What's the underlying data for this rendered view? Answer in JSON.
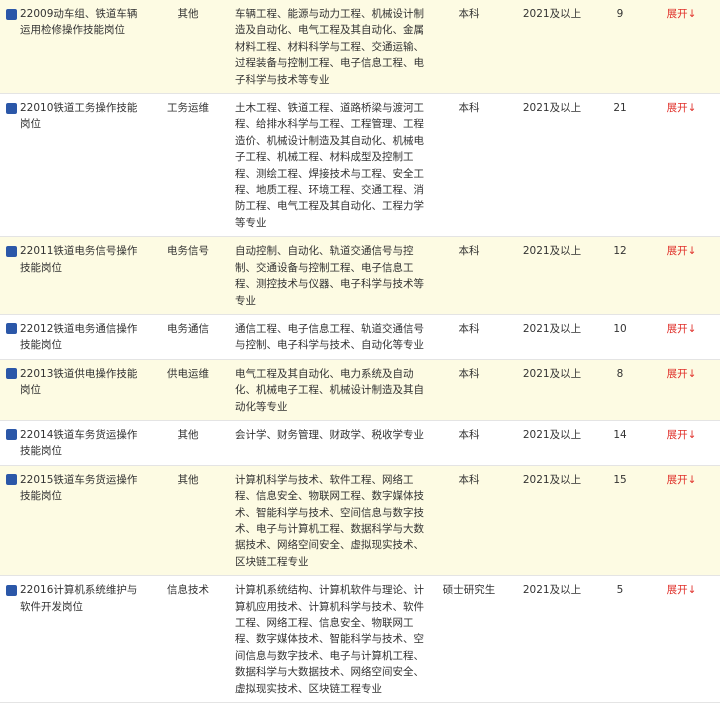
{
  "table": {
    "rows": [
      {
        "name": "22009动车组、铁道车辆运用检修操作技能岗位",
        "type": "其他",
        "major": "车辆工程、能源与动力工程、机械设计制造及自动化、电气工程及其自动化、金属材料工程、材料科学与工程、交通运输、过程装备与控制工程、电子信息工程、电子科学与技术等专业",
        "edu": "本科",
        "year": "2021及以上",
        "count": "9",
        "toggle": "展开",
        "arrow": "↓"
      },
      {
        "name": "22010铁道工务操作技能岗位",
        "type": "工务运维",
        "major": "土木工程、铁道工程、道路桥梁与渡河工程、给排水科学与工程、工程管理、工程造价、机械设计制造及其自动化、机械电子工程、机械工程、材料成型及控制工程、测绘工程、焊接技术与工程、安全工程、地质工程、环境工程、交通工程、消防工程、电气工程及其自动化、工程力学等专业",
        "edu": "本科",
        "year": "2021及以上",
        "count": "21",
        "toggle": "展开",
        "arrow": "↓"
      },
      {
        "name": "22011铁道电务信号操作技能岗位",
        "type": "电务信号",
        "major": "自动控制、自动化、轨道交通信号与控制、交通设备与控制工程、电子信息工程、测控技术与仪器、电子科学与技术等专业",
        "edu": "本科",
        "year": "2021及以上",
        "count": "12",
        "toggle": "展开",
        "arrow": "↓"
      },
      {
        "name": "22012铁道电务通信操作技能岗位",
        "type": "电务通信",
        "major": "通信工程、电子信息工程、轨道交通信号与控制、电子科学与技术、自动化等专业",
        "edu": "本科",
        "year": "2021及以上",
        "count": "10",
        "toggle": "展开",
        "arrow": "↓"
      },
      {
        "name": "22013铁道供电操作技能岗位",
        "type": "供电运维",
        "major": "电气工程及其自动化、电力系统及自动化、机械电子工程、机械设计制造及其自动化等专业",
        "edu": "本科",
        "year": "2021及以上",
        "count": "8",
        "toggle": "展开",
        "arrow": "↓"
      },
      {
        "name": "22014铁道车务货运操作技能岗位",
        "type": "其他",
        "major": "会计学、财务管理、财政学、税收学专业",
        "edu": "本科",
        "year": "2021及以上",
        "count": "14",
        "toggle": "展开",
        "arrow": "↓"
      },
      {
        "name": "22015铁道车务货运操作技能岗位",
        "type": "其他",
        "major": "计算机科学与技术、软件工程、网络工程、信息安全、物联网工程、数字媒体技术、智能科学与技术、空间信息与数字技术、电子与计算机工程、数据科学与大数据技术、网络空间安全、虚拟现实技术、区块链工程专业",
        "edu": "本科",
        "year": "2021及以上",
        "count": "15",
        "toggle": "展开",
        "arrow": "↓"
      },
      {
        "name": "22016计算机系统维护与软件开发岗位",
        "type": "信息技术",
        "major": "计算机系统结构、计算机软件与理论、计算机应用技术、计算机科学与技术、软件工程、网络工程、信息安全、物联网工程、数字媒体技术、智能科学与技术、空间信息与数字技术、电子与计算机工程、数据科学与大数据技术、网络空间安全、虚拟现实技术、区块链工程专业",
        "edu": "硕士研究生",
        "year": "2021及以上",
        "count": "5",
        "toggle": "展开",
        "arrow": "↓"
      }
    ]
  },
  "colors": {
    "accent_square": "#2b57a8",
    "toggle_red": "#e0312b",
    "row_highlight": "#fdfbe3"
  }
}
